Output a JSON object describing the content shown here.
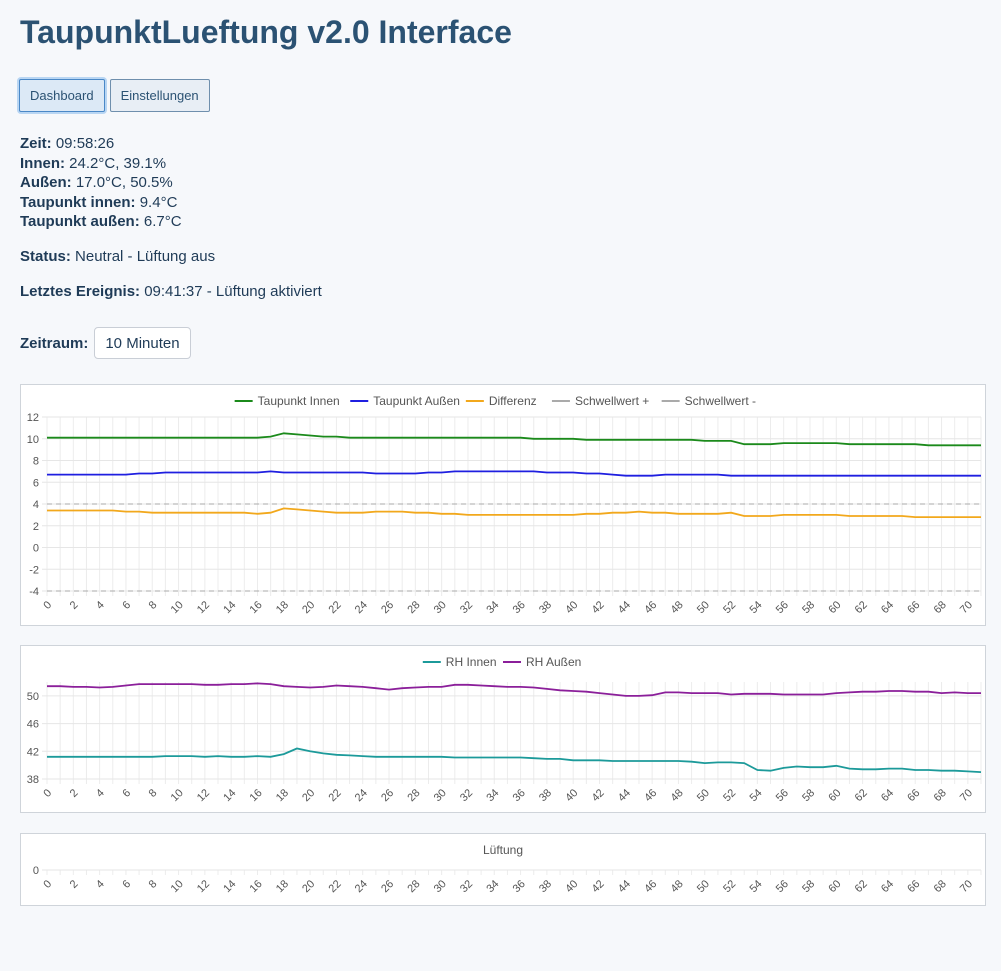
{
  "app": {
    "title": "TaupunktLueftung v2.0 Interface"
  },
  "nav": {
    "dashboard_label": "Dashboard",
    "settings_label": "Einstellungen"
  },
  "readings": {
    "zeit_label": "Zeit:",
    "zeit_value": "09:58:26",
    "innen_label": "Innen:",
    "innen_value": "24.2°C, 39.1%",
    "aussen_label": "Außen:",
    "aussen_value": "17.0°C, 50.5%",
    "tp_innen_label": "Taupunkt innen:",
    "tp_innen_value": "9.4°C",
    "tp_aussen_label": "Taupunkt außen:",
    "tp_aussen_value": "6.7°C"
  },
  "status": {
    "label": "Status:",
    "value": "Neutral - Lüftung aus"
  },
  "event": {
    "label": "Letztes Ereignis:",
    "value": "09:41:37 - Lüftung aktiviert"
  },
  "zeitraum": {
    "label": "Zeitraum:",
    "selected": "10 Minuten"
  },
  "chart_data": [
    {
      "type": "line",
      "x": [
        0,
        1,
        2,
        3,
        4,
        5,
        6,
        7,
        8,
        9,
        10,
        11,
        12,
        13,
        14,
        15,
        16,
        17,
        18,
        19,
        20,
        21,
        22,
        23,
        24,
        25,
        26,
        27,
        28,
        29,
        30,
        31,
        32,
        33,
        34,
        35,
        36,
        37,
        38,
        39,
        40,
        41,
        42,
        43,
        44,
        45,
        46,
        47,
        48,
        49,
        50,
        51,
        52,
        53,
        54,
        55,
        56,
        57,
        58,
        59,
        60,
        61,
        62,
        63,
        64,
        65,
        66,
        67,
        68,
        69,
        70,
        71
      ],
      "x_ticks": [
        "0",
        "2",
        "4",
        "6",
        "8",
        "10",
        "12",
        "14",
        "16",
        "18",
        "20",
        "22",
        "24",
        "26",
        "28",
        "30",
        "32",
        "34",
        "36",
        "38",
        "40",
        "42",
        "44",
        "46",
        "48",
        "50",
        "52",
        "54",
        "56",
        "58",
        "60",
        "62",
        "64",
        "66",
        "68",
        "70"
      ],
      "ylim": [
        -4,
        12
      ],
      "y_ticks": [
        "12",
        "10",
        "8",
        "6",
        "4",
        "2",
        "0",
        "-2",
        "-4"
      ],
      "grid": true,
      "legend": "top",
      "series": [
        {
          "name": "Taupunkt Innen",
          "color": "#1b8a1b",
          "dashed": false,
          "values": [
            10.1,
            10.1,
            10.1,
            10.1,
            10.1,
            10.1,
            10.1,
            10.1,
            10.1,
            10.1,
            10.1,
            10.1,
            10.1,
            10.1,
            10.1,
            10.1,
            10.1,
            10.2,
            10.5,
            10.4,
            10.3,
            10.2,
            10.2,
            10.1,
            10.1,
            10.1,
            10.1,
            10.1,
            10.1,
            10.1,
            10.1,
            10.1,
            10.1,
            10.1,
            10.1,
            10.1,
            10.1,
            10.0,
            10.0,
            10.0,
            10.0,
            9.9,
            9.9,
            9.9,
            9.9,
            9.9,
            9.9,
            9.9,
            9.9,
            9.9,
            9.8,
            9.8,
            9.8,
            9.5,
            9.5,
            9.5,
            9.6,
            9.6,
            9.6,
            9.6,
            9.6,
            9.5,
            9.5,
            9.5,
            9.5,
            9.5,
            9.5,
            9.4,
            9.4,
            9.4,
            9.4,
            9.4
          ]
        },
        {
          "name": "Taupunkt Außen",
          "color": "#1f1fe0",
          "dashed": false,
          "values": [
            6.7,
            6.7,
            6.7,
            6.7,
            6.7,
            6.7,
            6.7,
            6.8,
            6.8,
            6.9,
            6.9,
            6.9,
            6.9,
            6.9,
            6.9,
            6.9,
            6.9,
            7.0,
            6.9,
            6.9,
            6.9,
            6.9,
            6.9,
            6.9,
            6.9,
            6.8,
            6.8,
            6.8,
            6.8,
            6.9,
            6.9,
            7.0,
            7.0,
            7.0,
            7.0,
            7.0,
            7.0,
            7.0,
            6.9,
            6.9,
            6.9,
            6.8,
            6.8,
            6.7,
            6.6,
            6.6,
            6.6,
            6.7,
            6.7,
            6.7,
            6.7,
            6.7,
            6.6,
            6.6,
            6.6,
            6.6,
            6.6,
            6.6,
            6.6,
            6.6,
            6.6,
            6.6,
            6.6,
            6.6,
            6.6,
            6.6,
            6.6,
            6.6,
            6.6,
            6.6,
            6.6,
            6.6
          ]
        },
        {
          "name": "Differenz",
          "color": "#f2a81c",
          "dashed": false,
          "values": [
            3.4,
            3.4,
            3.4,
            3.4,
            3.4,
            3.4,
            3.3,
            3.3,
            3.2,
            3.2,
            3.2,
            3.2,
            3.2,
            3.2,
            3.2,
            3.2,
            3.1,
            3.2,
            3.6,
            3.5,
            3.4,
            3.3,
            3.2,
            3.2,
            3.2,
            3.3,
            3.3,
            3.3,
            3.2,
            3.2,
            3.1,
            3.1,
            3.0,
            3.0,
            3.0,
            3.0,
            3.0,
            3.0,
            3.0,
            3.0,
            3.0,
            3.1,
            3.1,
            3.2,
            3.2,
            3.3,
            3.2,
            3.2,
            3.1,
            3.1,
            3.1,
            3.1,
            3.2,
            2.9,
            2.9,
            2.9,
            3.0,
            3.0,
            3.0,
            3.0,
            3.0,
            2.9,
            2.9,
            2.9,
            2.9,
            2.9,
            2.8,
            2.8,
            2.8,
            2.8,
            2.8,
            2.8
          ]
        },
        {
          "name": "Schwellwert +",
          "color": "#aaaaaa",
          "dashed": true,
          "values": [
            4,
            4,
            4,
            4,
            4,
            4,
            4,
            4,
            4,
            4,
            4,
            4,
            4,
            4,
            4,
            4,
            4,
            4,
            4,
            4,
            4,
            4,
            4,
            4,
            4,
            4,
            4,
            4,
            4,
            4,
            4,
            4,
            4,
            4,
            4,
            4,
            4,
            4,
            4,
            4,
            4,
            4,
            4,
            4,
            4,
            4,
            4,
            4,
            4,
            4,
            4,
            4,
            4,
            4,
            4,
            4,
            4,
            4,
            4,
            4,
            4,
            4,
            4,
            4,
            4,
            4,
            4,
            4,
            4,
            4,
            4,
            4
          ]
        },
        {
          "name": "Schwellwert -",
          "color": "#aaaaaa",
          "dashed": true,
          "values": [
            -4,
            -4,
            -4,
            -4,
            -4,
            -4,
            -4,
            -4,
            -4,
            -4,
            -4,
            -4,
            -4,
            -4,
            -4,
            -4,
            -4,
            -4,
            -4,
            -4,
            -4,
            -4,
            -4,
            -4,
            -4,
            -4,
            -4,
            -4,
            -4,
            -4,
            -4,
            -4,
            -4,
            -4,
            -4,
            -4,
            -4,
            -4,
            -4,
            -4,
            -4,
            -4,
            -4,
            -4,
            -4,
            -4,
            -4,
            -4,
            -4,
            -4,
            -4,
            -4,
            -4,
            -4,
            -4,
            -4,
            -4,
            -4,
            -4,
            -4,
            -4,
            -4,
            -4,
            -4,
            -4,
            -4,
            -4,
            -4,
            -4,
            -4,
            -4,
            -4
          ]
        }
      ]
    },
    {
      "type": "line",
      "x": [
        0,
        1,
        2,
        3,
        4,
        5,
        6,
        7,
        8,
        9,
        10,
        11,
        12,
        13,
        14,
        15,
        16,
        17,
        18,
        19,
        20,
        21,
        22,
        23,
        24,
        25,
        26,
        27,
        28,
        29,
        30,
        31,
        32,
        33,
        34,
        35,
        36,
        37,
        38,
        39,
        40,
        41,
        42,
        43,
        44,
        45,
        46,
        47,
        48,
        49,
        50,
        51,
        52,
        53,
        54,
        55,
        56,
        57,
        58,
        59,
        60,
        61,
        62,
        63,
        64,
        65,
        66,
        67,
        68,
        69,
        70,
        71
      ],
      "x_ticks": [
        "0",
        "2",
        "4",
        "6",
        "8",
        "10",
        "12",
        "14",
        "16",
        "18",
        "20",
        "22",
        "24",
        "26",
        "28",
        "30",
        "32",
        "34",
        "36",
        "38",
        "40",
        "42",
        "44",
        "46",
        "48",
        "50",
        "52",
        "54",
        "56",
        "58",
        "60",
        "62",
        "64",
        "66",
        "68",
        "70"
      ],
      "ylim": [
        38,
        52
      ],
      "y_ticks": [
        "50",
        "46",
        "42",
        "38"
      ],
      "grid": true,
      "legend": "top",
      "series": [
        {
          "name": "RH Innen",
          "color": "#1c9a9a",
          "dashed": false,
          "values": [
            41.2,
            41.2,
            41.2,
            41.2,
            41.2,
            41.2,
            41.2,
            41.2,
            41.2,
            41.3,
            41.3,
            41.3,
            41.2,
            41.3,
            41.2,
            41.2,
            41.3,
            41.2,
            41.6,
            42.4,
            42.0,
            41.7,
            41.5,
            41.4,
            41.3,
            41.2,
            41.2,
            41.2,
            41.2,
            41.2,
            41.2,
            41.1,
            41.1,
            41.1,
            41.1,
            41.1,
            41.1,
            41.0,
            40.9,
            40.9,
            40.7,
            40.7,
            40.7,
            40.6,
            40.6,
            40.6,
            40.6,
            40.6,
            40.6,
            40.5,
            40.3,
            40.4,
            40.4,
            40.3,
            39.3,
            39.2,
            39.6,
            39.8,
            39.7,
            39.7,
            39.9,
            39.5,
            39.4,
            39.4,
            39.5,
            39.5,
            39.3,
            39.3,
            39.2,
            39.2,
            39.1,
            39.0
          ]
        },
        {
          "name": "RH Außen",
          "color": "#8b1f9a",
          "dashed": false,
          "values": [
            51.4,
            51.4,
            51.3,
            51.3,
            51.2,
            51.3,
            51.5,
            51.7,
            51.7,
            51.7,
            51.7,
            51.7,
            51.6,
            51.6,
            51.7,
            51.7,
            51.8,
            51.7,
            51.4,
            51.3,
            51.2,
            51.3,
            51.5,
            51.4,
            51.3,
            51.1,
            50.9,
            51.1,
            51.2,
            51.3,
            51.3,
            51.6,
            51.6,
            51.5,
            51.4,
            51.3,
            51.3,
            51.2,
            51.0,
            50.8,
            50.7,
            50.6,
            50.4,
            50.2,
            50.0,
            50.0,
            50.1,
            50.5,
            50.5,
            50.4,
            50.4,
            50.4,
            50.2,
            50.3,
            50.3,
            50.3,
            50.2,
            50.2,
            50.2,
            50.2,
            50.4,
            50.5,
            50.6,
            50.6,
            50.7,
            50.7,
            50.6,
            50.6,
            50.4,
            50.5,
            50.4,
            50.4
          ]
        }
      ]
    },
    {
      "type": "line",
      "x": [
        0,
        1,
        2,
        3,
        4,
        5,
        6,
        7,
        8,
        9,
        10,
        11,
        12,
        13,
        14,
        15,
        16,
        17,
        18,
        19,
        20,
        21,
        22,
        23,
        24,
        25,
        26,
        27,
        28,
        29,
        30,
        31,
        32,
        33,
        34,
        35,
        36,
        37,
        38,
        39,
        40,
        41,
        42,
        43,
        44,
        45,
        46,
        47,
        48,
        49,
        50,
        51,
        52,
        53,
        54,
        55,
        56,
        57,
        58,
        59,
        60,
        61,
        62,
        63,
        64,
        65,
        66,
        67,
        68,
        69,
        70,
        71
      ],
      "x_ticks": [
        "0",
        "2",
        "4",
        "6",
        "8",
        "10",
        "12",
        "14",
        "16",
        "18",
        "20",
        "22",
        "24",
        "26",
        "28",
        "30",
        "32",
        "34",
        "36",
        "38",
        "40",
        "42",
        "44",
        "46",
        "48",
        "50",
        "52",
        "54",
        "56",
        "58",
        "60",
        "62",
        "64",
        "66",
        "68",
        "70"
      ],
      "ylim": [
        0,
        0
      ],
      "y_ticks": [
        "0"
      ],
      "grid": true,
      "legend": "top",
      "series": [
        {
          "name": "Lüftung",
          "color": "#c9d6e0",
          "dashed": false,
          "values": []
        }
      ]
    }
  ]
}
